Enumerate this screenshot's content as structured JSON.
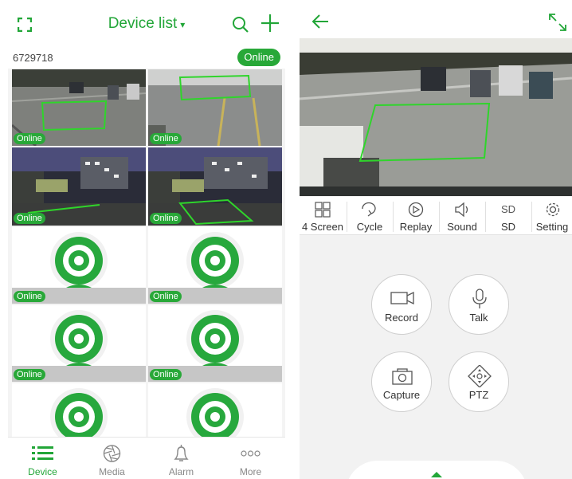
{
  "colors": {
    "accent": "#22a638",
    "online_badge": "#28a838"
  },
  "left": {
    "header": {
      "title": "Device list",
      "caret": "▾",
      "icons": [
        "fullscreen-icon",
        "search-icon",
        "plus-icon"
      ]
    },
    "device": {
      "id": "6729718",
      "status": "Online"
    },
    "cameras": [
      {
        "status": "Online"
      },
      {
        "status": "Online"
      },
      {
        "status": "Online"
      },
      {
        "status": "Online"
      },
      {
        "status": "Online"
      },
      {
        "status": "Online"
      },
      {
        "status": "Online"
      },
      {
        "status": "Online"
      }
    ],
    "tabs": [
      {
        "label": "Device",
        "icon": "list-icon"
      },
      {
        "label": "Media",
        "icon": "aperture-icon"
      },
      {
        "label": "Alarm",
        "icon": "bell-icon"
      },
      {
        "label": "More",
        "icon": "more-icon"
      }
    ]
  },
  "right": {
    "header": {
      "icons": [
        "back-arrow-icon",
        "expand-icon"
      ]
    },
    "toolbar": [
      {
        "label": "4 Screen",
        "icon": "grid-icon"
      },
      {
        "label": "Cycle",
        "icon": "cycle-icon"
      },
      {
        "label": "Replay",
        "icon": "replay-icon"
      },
      {
        "label": "Sound",
        "icon": "speaker-icon"
      },
      {
        "label": "SD",
        "icon_text": "SD"
      },
      {
        "label": "Setting",
        "icon": "gear-icon"
      }
    ],
    "controls": [
      {
        "label": "Record",
        "icon": "video-camera-icon"
      },
      {
        "label": "Talk",
        "icon": "microphone-icon"
      },
      {
        "label": "Capture",
        "icon": "camera-icon"
      },
      {
        "label": "PTZ",
        "icon": "ptz-icon"
      }
    ]
  }
}
